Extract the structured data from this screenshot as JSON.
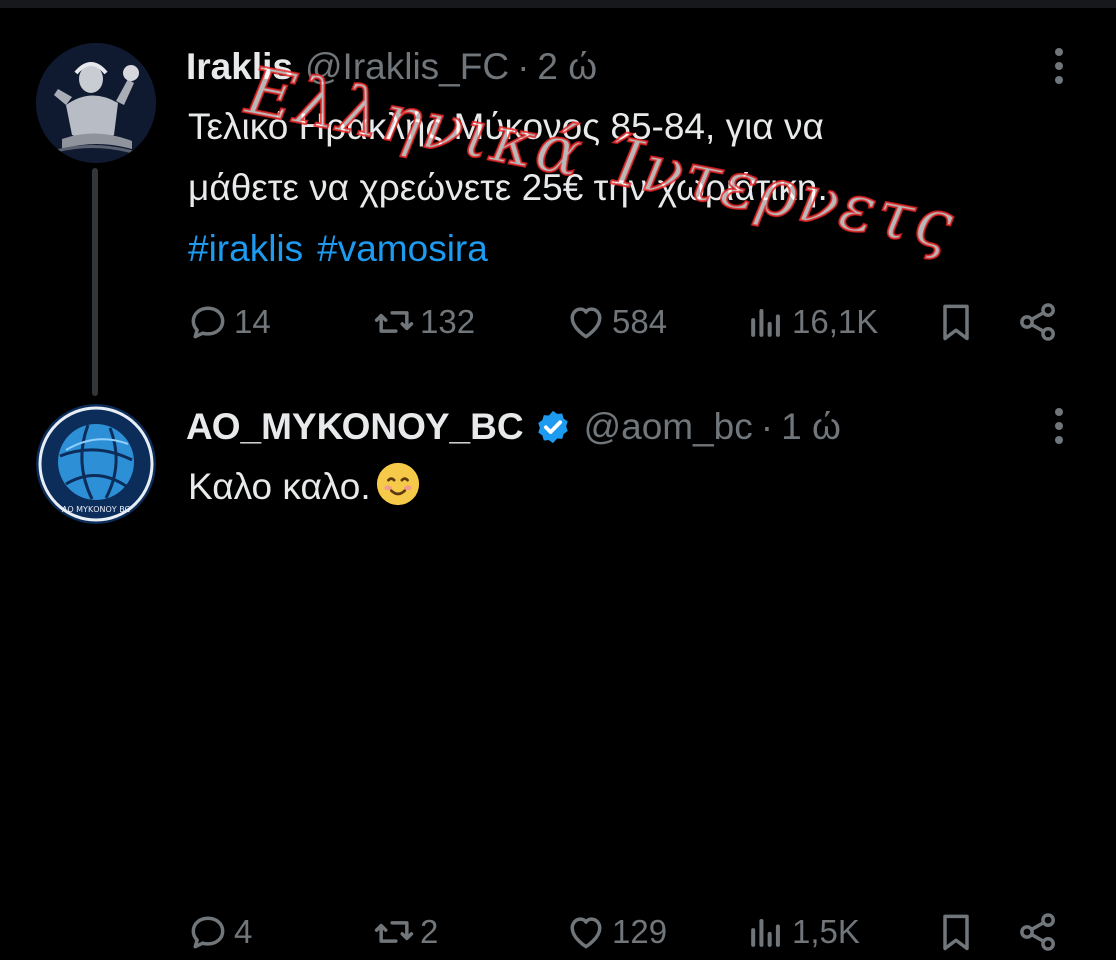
{
  "tweets": [
    {
      "name": "Iraklis",
      "handle": "@Iraklis_FC",
      "separator": "·",
      "time": "2 ώ",
      "text_lines": [
        "Τελικό Ηρακλής Μύκονος 85-84, για να",
        "μάθετε να χρεώνετε 25€ την χωριάτικη."
      ],
      "hashtags": [
        "#iraklis",
        "#vamosira"
      ],
      "verified": false,
      "avatar_icon": "hercules-statue-avatar",
      "stats": {
        "replies": "14",
        "retweets": "132",
        "likes": "584",
        "views": "16,1K"
      }
    },
    {
      "name": "ΑΟ_ΜΥΚΟΝΟΥ_BC",
      "handle": "@aom_bc",
      "separator": "·",
      "time": "1 ώ",
      "text": "Καλο καλο.",
      "emoji": "smiling-face-emoji",
      "verified": true,
      "avatar_icon": "basketball-logo-avatar",
      "avatar_text": "ΑΟ ΜΥΚΟΝΟΥ BC",
      "stats": {
        "replies": "4",
        "retweets": "2",
        "likes": "129",
        "views": "1,5K"
      }
    }
  ],
  "watermark_text": "Ελληνικά Ίντερνετς",
  "colors": {
    "background": "#000000",
    "text": "#e7e9ea",
    "secondary": "#71767b",
    "link": "#1d9bf0",
    "verified": "#1d9bf0"
  }
}
